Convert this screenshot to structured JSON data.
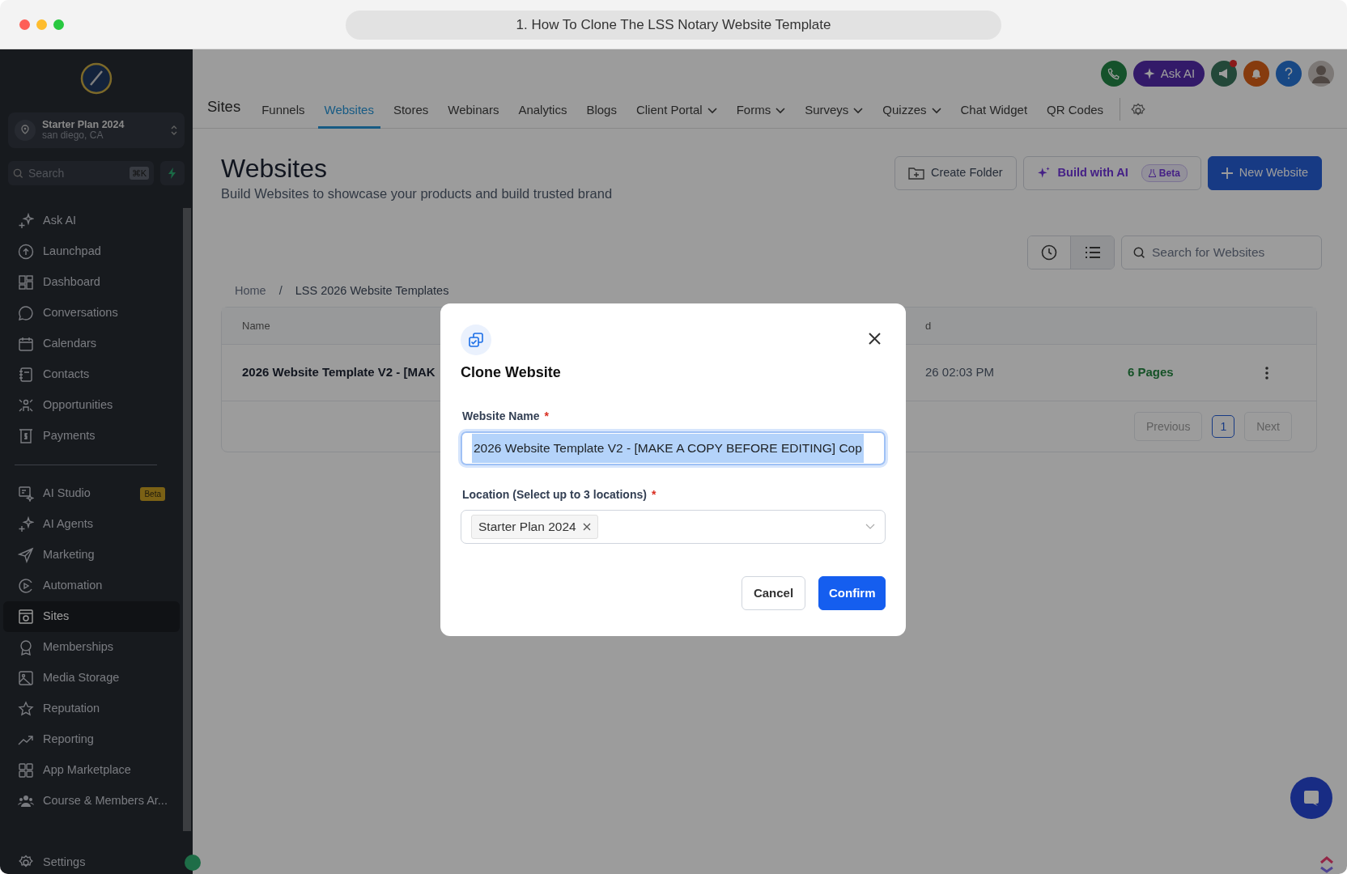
{
  "window": {
    "title": "1. How To Clone The LSS Notary Website Template"
  },
  "sidebar": {
    "account": {
      "name": "Starter Plan 2024",
      "location": "san diego, CA"
    },
    "search": {
      "placeholder": "Search",
      "shortcut": "⌘K"
    },
    "items": [
      {
        "label": "Ask AI",
        "selected": false
      },
      {
        "label": "Launchpad",
        "selected": false
      },
      {
        "label": "Dashboard",
        "selected": false
      },
      {
        "label": "Conversations",
        "selected": false
      },
      {
        "label": "Calendars",
        "selected": false
      },
      {
        "label": "Contacts",
        "selected": false
      },
      {
        "label": "Opportunities",
        "selected": false
      },
      {
        "label": "Payments",
        "selected": false
      },
      {
        "label": "AI Studio",
        "selected": false,
        "badge": "Beta"
      },
      {
        "label": "AI Agents",
        "selected": false
      },
      {
        "label": "Marketing",
        "selected": false
      },
      {
        "label": "Automation",
        "selected": false
      },
      {
        "label": "Sites",
        "selected": true
      },
      {
        "label": "Memberships",
        "selected": false
      },
      {
        "label": "Media Storage",
        "selected": false
      },
      {
        "label": "Reputation",
        "selected": false
      },
      {
        "label": "Reporting",
        "selected": false
      },
      {
        "label": "App Marketplace",
        "selected": false
      },
      {
        "label": "Course & Members Ar...",
        "selected": false
      }
    ],
    "settings": "Settings"
  },
  "header": {
    "ask_ai": "Ask AI",
    "section": "Sites",
    "tabs": [
      {
        "label": "Funnels",
        "selected": false,
        "dropdown": false
      },
      {
        "label": "Websites",
        "selected": true,
        "dropdown": false
      },
      {
        "label": "Stores",
        "selected": false,
        "dropdown": false
      },
      {
        "label": "Webinars",
        "selected": false,
        "dropdown": false
      },
      {
        "label": "Analytics",
        "selected": false,
        "dropdown": false
      },
      {
        "label": "Blogs",
        "selected": false,
        "dropdown": false
      },
      {
        "label": "Client Portal",
        "selected": false,
        "dropdown": true
      },
      {
        "label": "Forms",
        "selected": false,
        "dropdown": true
      },
      {
        "label": "Surveys",
        "selected": false,
        "dropdown": true
      },
      {
        "label": "Quizzes",
        "selected": false,
        "dropdown": true
      },
      {
        "label": "Chat Widget",
        "selected": false,
        "dropdown": false
      },
      {
        "label": "QR Codes",
        "selected": false,
        "dropdown": false
      }
    ]
  },
  "page": {
    "title": "Websites",
    "subtitle": "Build Websites to showcase your products and build trusted brand",
    "buttons": {
      "create_folder": "Create Folder",
      "build_ai": "Build with AI",
      "beta": "Beta",
      "new": "New Website"
    },
    "search": {
      "placeholder": "Search for Websites"
    },
    "breadcrumb": [
      "Home",
      "/",
      "LSS 2026 Website Templates"
    ],
    "table": {
      "columns": [
        "Name",
        "d"
      ],
      "rows": [
        {
          "name": "2026 Website Template V2 - [MAK",
          "date": "26 02:03 PM",
          "pages": "6 Pages"
        }
      ]
    },
    "pager": {
      "previous": "Previous",
      "page": "1",
      "next": "Next"
    }
  },
  "dialog": {
    "title": "Clone Website",
    "name_label": "Website Name",
    "name_value": "2026 Website Template V2 - [MAKE A COPY BEFORE EDITING] Cop",
    "name_selected": true,
    "required_mark": "*",
    "location_label": "Location (Select up to 3 locations)",
    "locations": [
      "Starter Plan 2024"
    ],
    "cancel": "Cancel",
    "confirm": "Confirm"
  }
}
